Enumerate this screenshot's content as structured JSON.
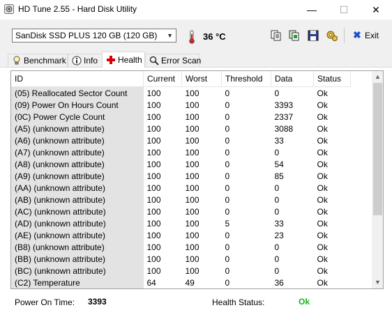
{
  "window": {
    "title": "HD Tune 2.55 - Hard Disk Utility",
    "minimize": "—",
    "maximize": "☐",
    "close": "✕"
  },
  "toolbar": {
    "drive": "SanDisk SSD PLUS 120 GB (120 GB)",
    "temperature": "36 °C",
    "exit_label": "Exit"
  },
  "tabs": [
    {
      "label": "Benchmark",
      "icon": "lightbulb-icon"
    },
    {
      "label": "Info",
      "icon": "info-icon"
    },
    {
      "label": "Health",
      "icon": "health-cross-icon",
      "active": true
    },
    {
      "label": "Error Scan",
      "icon": "magnifier-icon"
    }
  ],
  "table": {
    "headers": [
      "ID",
      "Current",
      "Worst",
      "Threshold",
      "Data",
      "Status"
    ],
    "rows": [
      [
        "(05) Reallocated Sector Count",
        "100",
        "100",
        "0",
        "0",
        "Ok"
      ],
      [
        "(09) Power On Hours Count",
        "100",
        "100",
        "0",
        "3393",
        "Ok"
      ],
      [
        "(0C) Power Cycle Count",
        "100",
        "100",
        "0",
        "2337",
        "Ok"
      ],
      [
        "(A5) (unknown attribute)",
        "100",
        "100",
        "0",
        "3088",
        "Ok"
      ],
      [
        "(A6) (unknown attribute)",
        "100",
        "100",
        "0",
        "33",
        "Ok"
      ],
      [
        "(A7) (unknown attribute)",
        "100",
        "100",
        "0",
        "0",
        "Ok"
      ],
      [
        "(A8) (unknown attribute)",
        "100",
        "100",
        "0",
        "54",
        "Ok"
      ],
      [
        "(A9) (unknown attribute)",
        "100",
        "100",
        "0",
        "85",
        "Ok"
      ],
      [
        "(AA) (unknown attribute)",
        "100",
        "100",
        "0",
        "0",
        "Ok"
      ],
      [
        "(AB) (unknown attribute)",
        "100",
        "100",
        "0",
        "0",
        "Ok"
      ],
      [
        "(AC) (unknown attribute)",
        "100",
        "100",
        "0",
        "0",
        "Ok"
      ],
      [
        "(AD) (unknown attribute)",
        "100",
        "100",
        "5",
        "33",
        "Ok"
      ],
      [
        "(AE) (unknown attribute)",
        "100",
        "100",
        "0",
        "23",
        "Ok"
      ],
      [
        "(B8) (unknown attribute)",
        "100",
        "100",
        "0",
        "0",
        "Ok"
      ],
      [
        "(BB) (unknown attribute)",
        "100",
        "100",
        "0",
        "0",
        "Ok"
      ],
      [
        "(BC) (unknown attribute)",
        "100",
        "100",
        "0",
        "0",
        "Ok"
      ],
      [
        "(C2) Temperature",
        "64",
        "49",
        "0",
        "36",
        "Ok"
      ]
    ]
  },
  "footer": {
    "power_on_label": "Power On Time:",
    "power_on_value": "3393",
    "health_label": "Health Status:",
    "health_value": "Ok",
    "health_color": "#19b419"
  },
  "colors": {
    "exit_x": "#1f4fd1",
    "health_cross": "#d80000",
    "thermo": "#e02020"
  }
}
